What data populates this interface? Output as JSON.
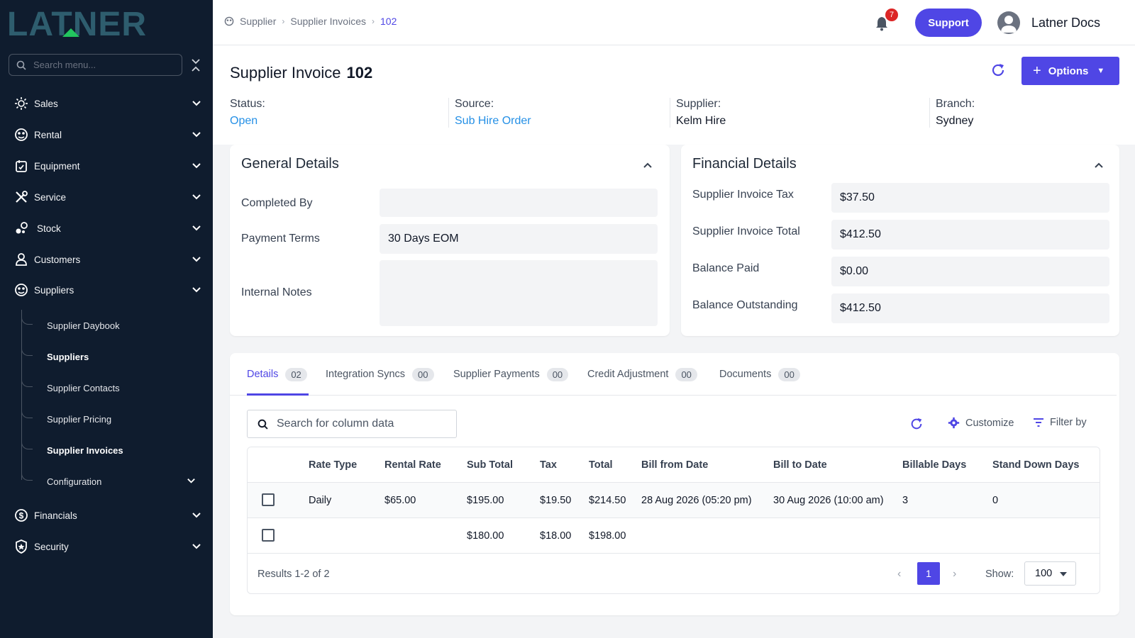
{
  "brand": {
    "logo_text": "LATNER"
  },
  "sidebar": {
    "search_placeholder": "Search menu...",
    "items": [
      {
        "label": "Sales",
        "icon": "sales-icon"
      },
      {
        "label": "Rental",
        "icon": "rental-icon"
      },
      {
        "label": "Equipment",
        "icon": "equipment-icon"
      },
      {
        "label": "Service",
        "icon": "service-icon"
      },
      {
        "label": "Stock",
        "icon": "stock-icon"
      },
      {
        "label": "Customers",
        "icon": "customers-icon"
      },
      {
        "label": "Suppliers",
        "icon": "suppliers-icon"
      },
      {
        "label": "Financials",
        "icon": "financials-icon"
      },
      {
        "label": "Security",
        "icon": "security-icon"
      }
    ],
    "suppliers_sub": [
      {
        "label": "Supplier Daybook"
      },
      {
        "label": "Suppliers"
      },
      {
        "label": "Supplier Contacts"
      },
      {
        "label": "Supplier Pricing"
      },
      {
        "label": "Supplier Invoices"
      },
      {
        "label": "Configuration"
      }
    ]
  },
  "topbar": {
    "breadcrumb": [
      "Supplier",
      "Supplier Invoices",
      "102"
    ],
    "notifications": "7",
    "support_label": "Support",
    "user_name": "Latner Docs"
  },
  "header": {
    "title": "Supplier Invoice",
    "number": "102",
    "options_label": "Options",
    "meta": [
      {
        "key": "Status:",
        "value": "Open"
      },
      {
        "key": "Source:",
        "value": "Sub Hire Order"
      },
      {
        "key": "Supplier:",
        "value": "Kelm Hire"
      },
      {
        "key": "Branch:",
        "value": "Sydney"
      }
    ]
  },
  "general": {
    "title": "General Details",
    "fields": [
      {
        "label": "Completed By",
        "value": ""
      },
      {
        "label": "Payment Terms",
        "value": "30 Days EOM"
      },
      {
        "label": "Internal Notes",
        "value": ""
      }
    ]
  },
  "financial": {
    "title": "Financial Details",
    "fields": [
      {
        "label": "Supplier Invoice Tax",
        "value": "$37.50"
      },
      {
        "label": "Supplier Invoice Total",
        "value": "$412.50"
      },
      {
        "label": "Balance Paid",
        "value": "$0.00"
      },
      {
        "label": "Balance Outstanding",
        "value": "$412.50"
      }
    ]
  },
  "tabs": [
    {
      "label": "Details",
      "count": "02"
    },
    {
      "label": "Integration Syncs",
      "count": "00"
    },
    {
      "label": "Supplier Payments",
      "count": "00"
    },
    {
      "label": "Credit Adjustment",
      "count": "00"
    },
    {
      "label": "Documents",
      "count": "00"
    }
  ],
  "table": {
    "search_placeholder": "Search for column data",
    "customize_label": "Customize",
    "filter_label": "Filter by",
    "columns": [
      "Rate Type",
      "Rental Rate",
      "Sub Total",
      "Tax",
      "Total",
      "Bill from Date",
      "Bill to Date",
      "Billable Days",
      "Stand Down Days"
    ],
    "rows": [
      [
        "Daily",
        "$65.00",
        "$195.00",
        "$19.50",
        "$214.50",
        "28 Aug 2026 (05:20 pm)",
        "30 Aug 2026 (10:00 am)",
        "3",
        "0"
      ],
      [
        "",
        "",
        "$180.00",
        "$18.00",
        "$198.00",
        "",
        "",
        "",
        ""
      ]
    ],
    "results": "Results 1-2 of 2",
    "page": "1",
    "show_label": "Show:",
    "page_size": "100"
  },
  "colors": {
    "accent": "#4f46e5",
    "link": "#2590e6",
    "sidebar": "#0f1c2e"
  }
}
